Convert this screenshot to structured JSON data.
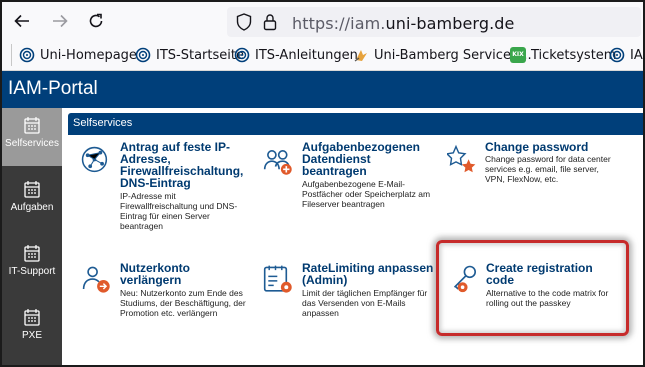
{
  "browser": {
    "url_prefix": "https://iam.",
    "url_host": "uni-bamberg.de",
    "bookmarks": [
      {
        "label": "Uni-Homepage",
        "icon": "uni-logo-icon"
      },
      {
        "label": "ITS-Startseite",
        "icon": "uni-logo-icon"
      },
      {
        "label": "ITS-Anleitungen",
        "icon": "uni-logo-icon"
      },
      {
        "label": "Uni-Bamberg Serviced...",
        "icon": "servicedesk-icon"
      },
      {
        "label": "Ticketsystem",
        "icon": "kix-icon",
        "icon_text": "KIX"
      },
      {
        "label": "IA",
        "icon": "uni-logo-icon"
      }
    ]
  },
  "portal": {
    "title": "IAM-Portal",
    "section_title": "Selfservices",
    "accent_color": "#003f7a",
    "highlight_color": "#c62b2b"
  },
  "sidebar": {
    "items": [
      {
        "label": "Selfservices",
        "active": true
      },
      {
        "label": "Aufgaben",
        "active": false
      },
      {
        "label": "IT-Support",
        "active": false
      },
      {
        "label": "PXE",
        "active": false
      }
    ]
  },
  "tiles": [
    {
      "title": "Antrag auf feste IP-Adresse, Firewallfreischaltung, DNS-Eintrag",
      "title_lines": [
        "Antrag auf feste IP-",
        "Adresse,",
        "Firewallfreischaltung,",
        "DNS-Eintrag"
      ],
      "desc_lines": [
        "IP-Adresse mit",
        "Firewallfreischaltung und DNS-",
        "Eintrag für einen Server",
        "beantragen"
      ],
      "icon": "network-icon"
    },
    {
      "title": "Aufgabenbezogenen Datendienst beantragen",
      "title_lines": [
        "Aufgabenbezogenen",
        "Datendienst",
        "beantragen"
      ],
      "desc_lines": [
        "Aufgabenbezogene E-Mail-",
        "Postfächer oder Speicherplatz am",
        "Fileserver beantragen"
      ],
      "icon": "group-add-icon"
    },
    {
      "title": "Change password",
      "title_lines": [
        "Change password"
      ],
      "desc_lines": [
        "Change password for data center",
        "services e.g. email, file server,",
        "VPN, FlexNow, etc."
      ],
      "icon": "password-star-icon"
    },
    {
      "title": "Nutzerkonto verlängern",
      "title_lines": [
        "Nutzerkonto",
        "verlängern"
      ],
      "desc_lines": [
        "Neu: Nutzerkonto zum Ende des",
        "Studiums, der Beschäftigung, der",
        "Promotion etc. verlängern"
      ],
      "icon": "user-extend-icon"
    },
    {
      "title": "RateLimiting anpassen (Admin)",
      "title_lines": [
        "RateLimiting anpassen",
        "(Admin)"
      ],
      "desc_lines": [
        "Limit der täglichen Empfänger für",
        "das Versenden von E-Mails",
        "anpassen"
      ],
      "icon": "ratelimit-gear-icon"
    },
    {
      "title": "Create registration code",
      "title_lines": [
        "Create registration",
        "code"
      ],
      "desc_lines": [
        "Alternative to the code matrix for",
        "rolling out the passkey"
      ],
      "icon": "key-gear-icon"
    }
  ]
}
